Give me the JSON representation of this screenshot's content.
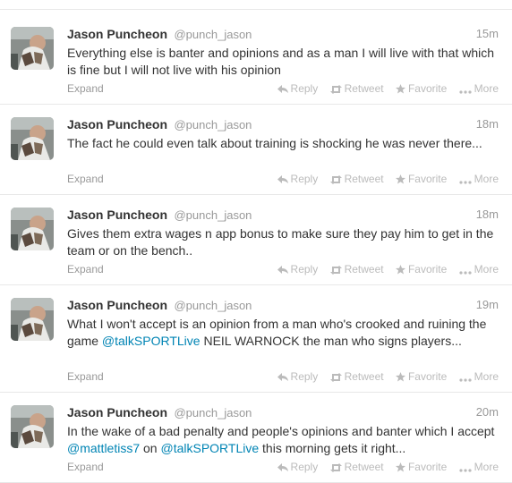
{
  "tweets": [
    {
      "name": "Jason Puncheon",
      "handle": "@punch_jason",
      "time": "15m",
      "segments": [
        {
          "t": "Everything else is banter and opinions and as a man I will live with that which is fine but I will not live with his opinion",
          "link": false
        }
      ]
    },
    {
      "name": "Jason Puncheon",
      "handle": "@punch_jason",
      "time": "18m",
      "segments": [
        {
          "t": "The fact he could even talk about training is shocking he was never there...",
          "link": false
        }
      ]
    },
    {
      "name": "Jason Puncheon",
      "handle": "@punch_jason",
      "time": "18m",
      "segments": [
        {
          "t": "Gives them extra wages n app bonus to make sure they pay him to get in the team or on the bench..",
          "link": false
        }
      ]
    },
    {
      "name": "Jason Puncheon",
      "handle": "@punch_jason",
      "time": "19m",
      "segments": [
        {
          "t": "What I won't accept is an opinion from a man who's crooked and ruining the game ",
          "link": false
        },
        {
          "t": "@talkSPORTLive",
          "link": true
        },
        {
          "t": " NEIL WARNOCK  the man who signs players...",
          "link": false
        }
      ]
    },
    {
      "name": "Jason Puncheon",
      "handle": "@punch_jason",
      "time": "20m",
      "segments": [
        {
          "t": "In the wake of a bad penalty and people's opinions and banter which I accept ",
          "link": false
        },
        {
          "t": "@mattletiss7",
          "link": true
        },
        {
          "t": " on ",
          "link": false
        },
        {
          "t": "@talkSPORTLive",
          "link": true
        },
        {
          "t": " this morning gets it right...",
          "link": false
        }
      ]
    }
  ],
  "actions": {
    "expand": "Expand",
    "reply": "Reply",
    "retweet": "Retweet",
    "favorite": "Favorite",
    "more": "More"
  },
  "icons": {
    "reply": "reply-arrow-icon",
    "retweet": "retweet-icon",
    "favorite": "star-icon",
    "more": "ellipsis-icon"
  },
  "colors": {
    "link": "#0084b4",
    "muted": "#999999",
    "action": "#bbbbbb",
    "divider": "#e8e8e8"
  }
}
